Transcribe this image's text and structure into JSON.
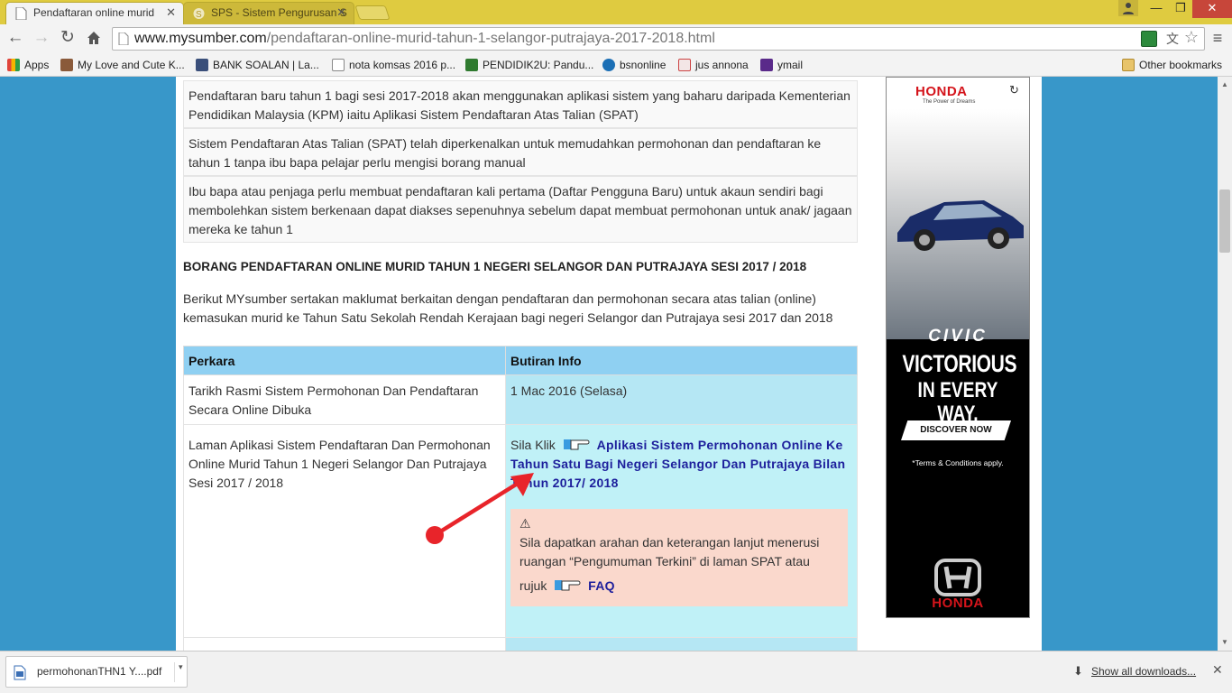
{
  "browser": {
    "tabs": [
      {
        "label": "Pendaftaran online murid",
        "close": "✕"
      },
      {
        "label": "SPS - Sistem Pengurusan S",
        "close": "✕"
      }
    ],
    "window_controls": {
      "minimize": "—",
      "restore": "❐",
      "close": "✕"
    },
    "url_domain": "www.mysumber.com",
    "url_path": "/pendaftaran-online-murid-tahun-1-selangor-putrajaya-2017-2018.html",
    "bookmarks": [
      {
        "label": "Apps",
        "icon": "apps-grid-icon"
      },
      {
        "label": "My Love and Cute K...",
        "icon": "photo-icon"
      },
      {
        "label": "BANK SOALAN | La...",
        "icon": "avatar-icon"
      },
      {
        "label": "nota komsas 2016 p...",
        "icon": "page-icon"
      },
      {
        "label": "PENDIDIK2U: Pandu...",
        "icon": "site-icon"
      },
      {
        "label": "bsnonline",
        "icon": "globe-icon"
      },
      {
        "label": "jus annona",
        "icon": "ribbon-icon"
      },
      {
        "label": "ymail",
        "icon": "mail-icon"
      }
    ],
    "other_bookmarks": "Other bookmarks"
  },
  "article": {
    "info_rows": [
      "Pendaftaran baru tahun 1 bagi sesi 2017-2018 akan menggunakan aplikasi sistem yang baharu daripada Kementerian Pendidikan Malaysia (KPM) iaitu Aplikasi Sistem Pendaftaran Atas Talian (SPAT)",
      "Sistem Pendaftaran Atas Talian (SPAT) telah diperkenalkan untuk memudahkan permohonan dan pendaftaran ke tahun 1 tanpa ibu bapa pelajar perlu mengisi borang manual",
      "Ibu bapa atau penjaga perlu membuat pendaftaran kali pertama (Daftar Pengguna Baru) untuk akaun sendiri bagi membolehkan sistem berkenaan dapat diakses sepenuhnya sebelum dapat membuat permohonan untuk anak/ jagaan mereka ke tahun 1"
    ],
    "heading": "BORANG PENDAFTARAN ONLINE MURID TAHUN 1 NEGERI SELANGOR DAN PUTRAJAYA SESI 2017 / 2018",
    "intro": "Berikut MYsumber sertakan maklumat berkaitan dengan pendaftaran dan permohonan secara atas talian (online) kemasukan murid ke Tahun Satu Sekolah Rendah Kerajaan bagi negeri Selangor dan Putrajaya sesi 2017 dan 2018",
    "table": {
      "headers": [
        "Perkara",
        "Butiran Info"
      ],
      "row1": {
        "perkara": "Tarikh Rasmi Sistem Permohonan Dan Pendaftaran Secara Online Dibuka",
        "info": "1 Mac 2016 (Selasa)"
      },
      "row2": {
        "perkara": "Laman Aplikasi Sistem Pendaftaran Dan Permohonan Online Murid Tahun 1 Negeri Selangor Dan Putrajaya Sesi 2017 / 2018",
        "prefix": "Sila Klik",
        "link": "Aplikasi Sistem Permohonan Online Ke Tahun Satu Bagi Negeri Selangor Dan Putrajaya Bilan Tahun 2017/ 2018",
        "note_icon": "⚠",
        "note_text": "Sila dapatkan arahan dan keterangan lanjut menerusi ruangan “Pengumuman Terkini” di laman SPAT atau",
        "note_rujuk": "rujuk",
        "faq": "FAQ"
      }
    }
  },
  "ad": {
    "brand": "HONDA",
    "tagline": "The Power of Dreams",
    "model": "CIVIC",
    "headline1": "VICTORIOUS",
    "headline2": "IN EVERY WAY.",
    "cta": "DISCOVER NOW",
    "terms": "*Terms & Conditions apply.",
    "brand_bottom": "HONDA"
  },
  "downloads": {
    "file": "permohonanTHN1 Y....pdf",
    "show_all": "Show all downloads..."
  },
  "colors": {
    "titlebar": "#dfcb40",
    "page_bg": "#3897c9",
    "table_header": "#8fd0f2",
    "info_cell": "#c0f1f7",
    "note_bg": "#fad8cc",
    "link": "#1d1f9c",
    "annotation_arrow": "#e8242a"
  }
}
